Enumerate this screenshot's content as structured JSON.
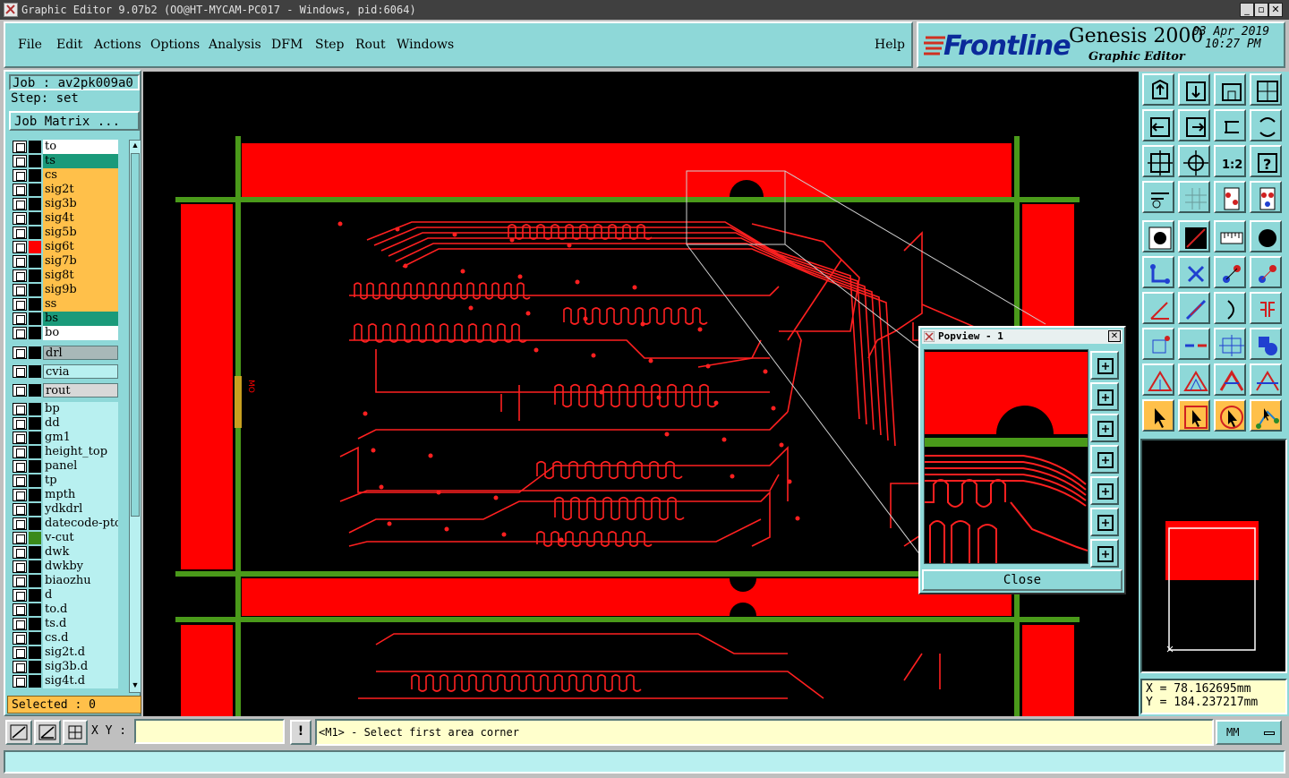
{
  "window": {
    "title": "Graphic Editor 9.07b2 (OO@HT-MYCAM-PC017 - Windows, pid:6064)",
    "min_label": "_",
    "max_label": "▫",
    "close_label": "✕"
  },
  "menu": {
    "items": [
      "File",
      "Edit",
      "Actions",
      "Options",
      "Analysis",
      "DFM",
      "Step",
      "Rout",
      "Windows"
    ],
    "help": "Help"
  },
  "brand": {
    "logo": "Frontline",
    "product": "Genesis 2000",
    "subtitle": "Graphic Editor",
    "date": "03 Apr 2019",
    "time": "10:27 PM"
  },
  "job": {
    "job_label": "Job : av2pk009a0",
    "step_label": "Step: set",
    "matrix_button": "Job Matrix ..."
  },
  "layers": [
    {
      "name": "to",
      "color": "#ffffff",
      "swatch": "#000000"
    },
    {
      "name": "ts",
      "color": "#1a9a7a",
      "swatch": "#000000"
    },
    {
      "name": "cs",
      "color": "#ffc04a",
      "swatch": "#000000"
    },
    {
      "name": "sig2t",
      "color": "#ffc04a",
      "swatch": "#000000"
    },
    {
      "name": "sig3b",
      "color": "#ffc04a",
      "swatch": "#000000"
    },
    {
      "name": "sig4t",
      "color": "#ffc04a",
      "swatch": "#000000"
    },
    {
      "name": "sig5b",
      "color": "#ffc04a",
      "swatch": "#000000"
    },
    {
      "name": "sig6t",
      "color": "#ffc04a",
      "swatch": "#ff0000"
    },
    {
      "name": "sig7b",
      "color": "#ffc04a",
      "swatch": "#000000"
    },
    {
      "name": "sig8t",
      "color": "#ffc04a",
      "swatch": "#000000"
    },
    {
      "name": "sig9b",
      "color": "#ffc04a",
      "swatch": "#000000"
    },
    {
      "name": "ss",
      "color": "#ffc04a",
      "swatch": "#000000"
    },
    {
      "name": "bs",
      "color": "#1a9a7a",
      "swatch": "#000000"
    },
    {
      "name": "bo",
      "color": "#ffffff",
      "swatch": "#000000"
    }
  ],
  "drill_layers": [
    {
      "name": "drl",
      "color": "#a8b8b8"
    },
    {
      "name": "cvia",
      "color": "#b8f0f0"
    },
    {
      "name": "rout",
      "color": "#d8d8d8"
    }
  ],
  "misc_layers": [
    {
      "name": "bp",
      "swatch": "#000000"
    },
    {
      "name": "dd",
      "swatch": "#000000"
    },
    {
      "name": "gm1",
      "swatch": "#000000"
    },
    {
      "name": "height_top",
      "swatch": "#000000"
    },
    {
      "name": "panel",
      "swatch": "#000000"
    },
    {
      "name": "tp",
      "swatch": "#000000"
    },
    {
      "name": "mpth",
      "swatch": "#000000"
    },
    {
      "name": "ydkdrl",
      "swatch": "#000000"
    },
    {
      "name": "datecode-ptc",
      "swatch": "#000000"
    },
    {
      "name": "v-cut",
      "swatch": "#3a8a1a"
    },
    {
      "name": "dwk",
      "swatch": "#000000"
    },
    {
      "name": "dwkby",
      "swatch": "#000000"
    },
    {
      "name": "biaozhu",
      "swatch": "#000000"
    },
    {
      "name": "d",
      "swatch": "#000000"
    },
    {
      "name": "to.d",
      "swatch": "#000000"
    },
    {
      "name": "ts.d",
      "swatch": "#000000"
    },
    {
      "name": "cs.d",
      "swatch": "#000000"
    },
    {
      "name": "sig2t.d",
      "swatch": "#000000"
    },
    {
      "name": "sig3b.d",
      "swatch": "#000000"
    },
    {
      "name": "sig4t.d",
      "swatch": "#000000"
    }
  ],
  "selected": "Selected : 0",
  "canvas": {
    "mark_label": "MO"
  },
  "popview": {
    "title": "Popview - 1",
    "close_label": "Close"
  },
  "coords": {
    "x": "X  =  78.162695mm",
    "y": "Y  =  184.237217mm"
  },
  "status": {
    "xy_label": "X Y :",
    "xy_value": "",
    "message": "<M1> - Select first area corner",
    "units": "MM"
  },
  "colors": {
    "panel_bg": "#8ed8d8",
    "copper": "#ff0000",
    "vcut": "#4a9a1a",
    "canvas_bg": "#000000"
  }
}
